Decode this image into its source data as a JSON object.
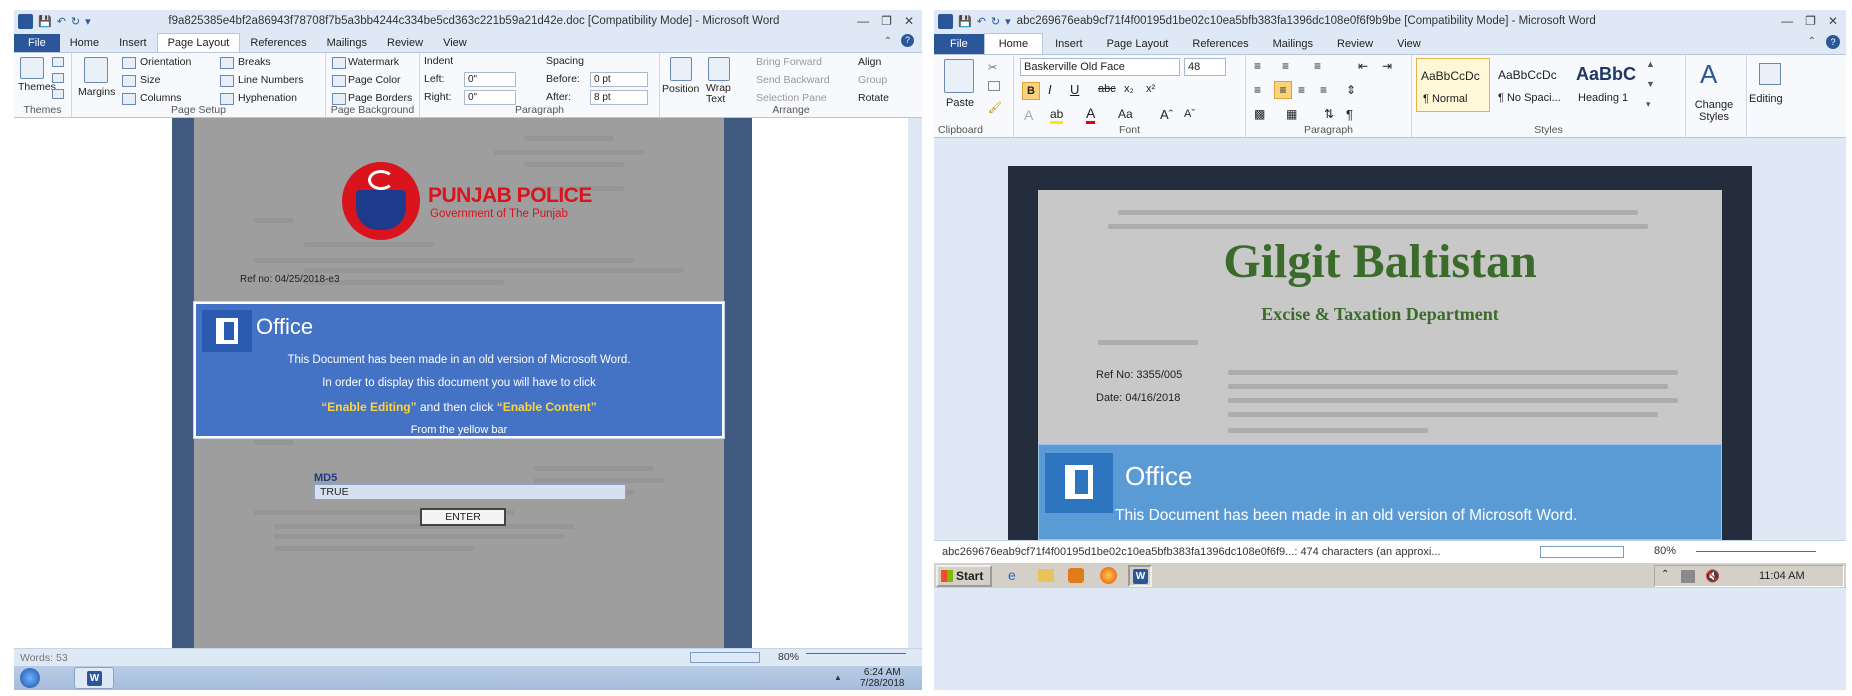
{
  "left": {
    "window_title": "f9a825385e4bf2a86943f78708f7b5a3bb4244c334be5cd363c221b59a21d42e.doc [Compatibility Mode] - Microsoft Word",
    "tabs": [
      "File",
      "Home",
      "Insert",
      "Page Layout",
      "References",
      "Mailings",
      "Review",
      "View"
    ],
    "active_tab": "Page Layout",
    "ribbon": {
      "themes": {
        "label": "Themes",
        "group": "Themes"
      },
      "page_setup": {
        "margins": "Margins",
        "orientation": "Orientation",
        "size": "Size",
        "columns": "Columns",
        "breaks": "Breaks",
        "line_numbers": "Line Numbers",
        "hyphenation": "Hyphenation",
        "group": "Page Setup"
      },
      "page_background": {
        "watermark": "Watermark",
        "page_color": "Page Color",
        "page_borders": "Page Borders",
        "group": "Page Background"
      },
      "paragraph": {
        "indent": "Indent",
        "left_label": "Left:",
        "left_value": "0\"",
        "right_label": "Right:",
        "right_value": "0\"",
        "spacing": "Spacing",
        "before_label": "Before:",
        "before_value": "0 pt",
        "after_label": "After:",
        "after_value": "8 pt",
        "group": "Paragraph"
      },
      "arrange": {
        "position": "Position",
        "wrap_text": "Wrap Text",
        "bring_forward": "Bring Forward",
        "send_backward": "Send Backward",
        "selection_pane": "Selection Pane",
        "align": "Align",
        "group_btn": "Group",
        "rotate": "Rotate",
        "group": "Arrange"
      }
    },
    "document": {
      "logo_title": "PUNJAB POLICE",
      "logo_subtitle": "Government of The Punjab",
      "ref_no": "Ref no: 04/25/2018-e3",
      "office_brand": "Office",
      "line1": "This Document has been made in an old version of Microsoft Word.",
      "line2": "In order to display this document you will have to click",
      "enable_editing": "“Enable Editing”",
      "and_then": " and then click ",
      "enable_content": "“Enable Content”",
      "line4": "From the yellow bar",
      "md5_label": "MD5",
      "md5_value": "TRUE",
      "enter_button": "ENTER"
    },
    "status": {
      "words": "Words: 53",
      "zoom": "80%"
    },
    "taskbar": {
      "time": "6:24 AM",
      "date": "7/28/2018"
    }
  },
  "right": {
    "window_title": "abc269676eab9cf71f4f00195d1be02c10ea5bfb383fa1396dc108e0f6f9b9be [Compatibility Mode] - Microsoft Word",
    "tabs": [
      "File",
      "Home",
      "Insert",
      "Page Layout",
      "References",
      "Mailings",
      "Review",
      "View"
    ],
    "active_tab": "Home",
    "ribbon": {
      "clipboard": {
        "paste": "Paste",
        "group": "Clipboard"
      },
      "font": {
        "font_name": "Baskerville Old Face",
        "font_size": "48",
        "group": "Font"
      },
      "paragraph": {
        "group": "Paragraph"
      },
      "styles": {
        "style1_preview": "AaBbCcDc",
        "style1_name": "¶ Normal",
        "style2_preview": "AaBbCcDc",
        "style2_name": "¶ No Spaci...",
        "style3_preview": "AaBbC",
        "style3_name": "Heading 1",
        "change_styles": "Change Styles",
        "group": "Styles"
      },
      "editing": {
        "label": "Editing"
      }
    },
    "document": {
      "heading": "Gilgit Baltistan",
      "subheading": "Excise & Taxation Department",
      "ref_no": "Ref No: 3355/005",
      "date": "Date: 04/16/2018",
      "office_brand": "Office",
      "line1": "This Document has been made in an old version of Microsoft Word."
    },
    "status": {
      "info": "abc269676eab9cf71f4f00195d1be02c10ea5bfb383fa1396dc108e0f6f9...: 474 characters (an approxi...",
      "zoom": "80%"
    },
    "taskbar": {
      "start": "Start",
      "time": "11:04 AM"
    }
  },
  "colors": {
    "office_blue_left": "#4472c4",
    "office_blue_right": "#5b9bd5",
    "police_red": "#d9141c",
    "gilgit_green": "#3a6b2a",
    "word_blue": "#2b579a"
  }
}
